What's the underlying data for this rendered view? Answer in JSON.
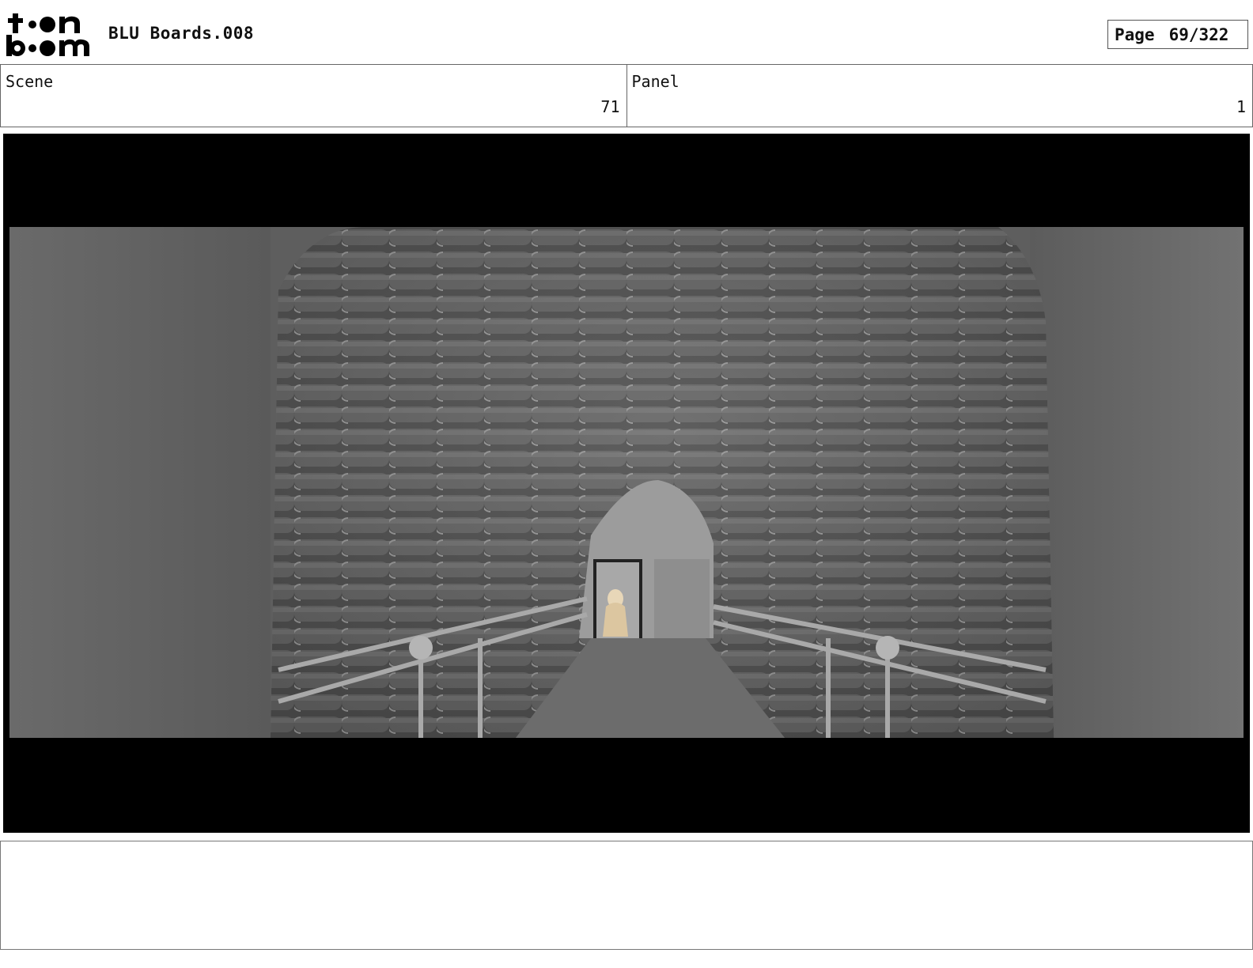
{
  "header": {
    "logo_text": "toonboom",
    "title": "BLU Boards.008",
    "page_label": "Page",
    "page_value": "69/322"
  },
  "info": {
    "scene_label": "Scene",
    "scene_value": "71",
    "panel_label": "Panel",
    "panel_value": "1"
  },
  "panel_image": {
    "description_icon": "tunnel-render-image"
  },
  "notes": {
    "text": ""
  }
}
